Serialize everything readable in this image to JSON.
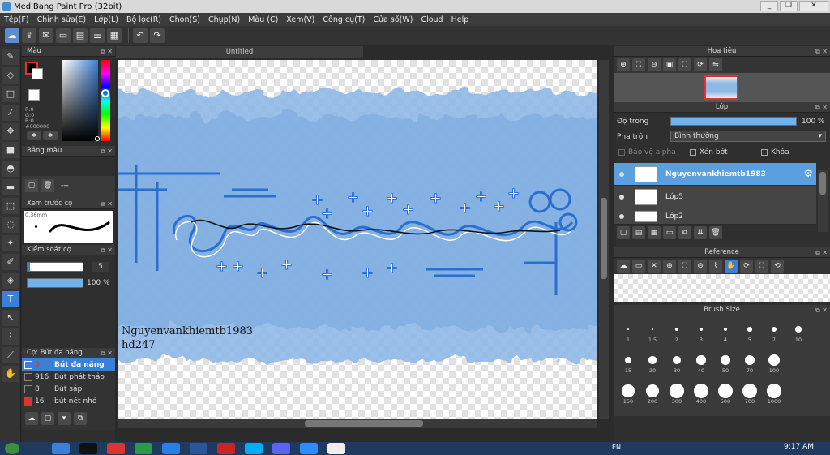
{
  "window": {
    "title": "MediBang Paint Pro (32bit)",
    "buttons": [
      "_",
      "❐",
      "✕"
    ]
  },
  "menu": [
    "Tệp(F)",
    "Chỉnh sửa(E)",
    "Lớp(L)",
    "Bộ lọc(R)",
    "Chọn(S)",
    "Chụp(N)",
    "Màu (C)",
    "Xem(V)",
    "Công cụ(T)",
    "Cửa số(W)",
    "Cloud",
    "Help"
  ],
  "document": {
    "tab_title": "Untitled"
  },
  "color_panel": {
    "title": "Màu",
    "r": "R:0",
    "g": "G:0",
    "b": "B:0",
    "hex": "#000000",
    "foreground": "#000000",
    "background": "#ffffff"
  },
  "palette_panel": {
    "title": "Bảng màu",
    "value": "---"
  },
  "brush_preview_panel": {
    "title": "Xem trước cọ",
    "size": "0.36mm"
  },
  "brush_control_panel": {
    "title": "Kiểm soát cọ",
    "size_value": "5",
    "opacity_value": "100 %",
    "opacity_fraction": 1.0
  },
  "brush_list_panel": {
    "title": "Cọ: Bút đa năng",
    "items": [
      {
        "size": "5",
        "name": "Bút đa năng",
        "color": "#3b7fd6"
      },
      {
        "size": "916",
        "name": "Bút phát thảo",
        "color": "#333333"
      },
      {
        "size": "8",
        "name": "Bút sáp",
        "color": "#333333"
      },
      {
        "size": "16",
        "name": "bút nét nhỏ",
        "color": "#e03030"
      }
    ]
  },
  "navigator_panel": {
    "title": "Hoa tiêu"
  },
  "layer_panel": {
    "title": "Lớp",
    "opacity_label": "Độ trong",
    "opacity_value": "100 %",
    "opacity_fraction": 1.0,
    "blend_label": "Pha trộn",
    "blend_value": "Bình thường",
    "protect_alpha": "Bảo vệ alpha",
    "clipping": "Xén bớt",
    "lock": "Khóa",
    "layers": [
      {
        "name": "Nguyenvankhiemtb1983",
        "selected": true
      },
      {
        "name": "Lớp5",
        "selected": false
      },
      {
        "name": "Lớp2",
        "selected": false
      }
    ]
  },
  "reference_panel": {
    "title": "Reference"
  },
  "brush_size_panel": {
    "title": "Brush Size",
    "sizes": [
      "1",
      "1.5",
      "2",
      "3",
      "4",
      "5",
      "7",
      "10",
      "15",
      "20",
      "30",
      "40",
      "50",
      "70",
      "100",
      "150",
      "200",
      "300",
      "400",
      "500",
      "700",
      "1000"
    ]
  },
  "canvas_text": {
    "line1": "Nguyenvankhiemtb1983",
    "line2": "hd247"
  },
  "taskbar": {
    "lang": "EN",
    "time": "9:17 AM"
  },
  "colors": {
    "accent": "#3b7fd6",
    "watercolor": "#8fb8e6",
    "lettering": "#2a6fd0"
  }
}
